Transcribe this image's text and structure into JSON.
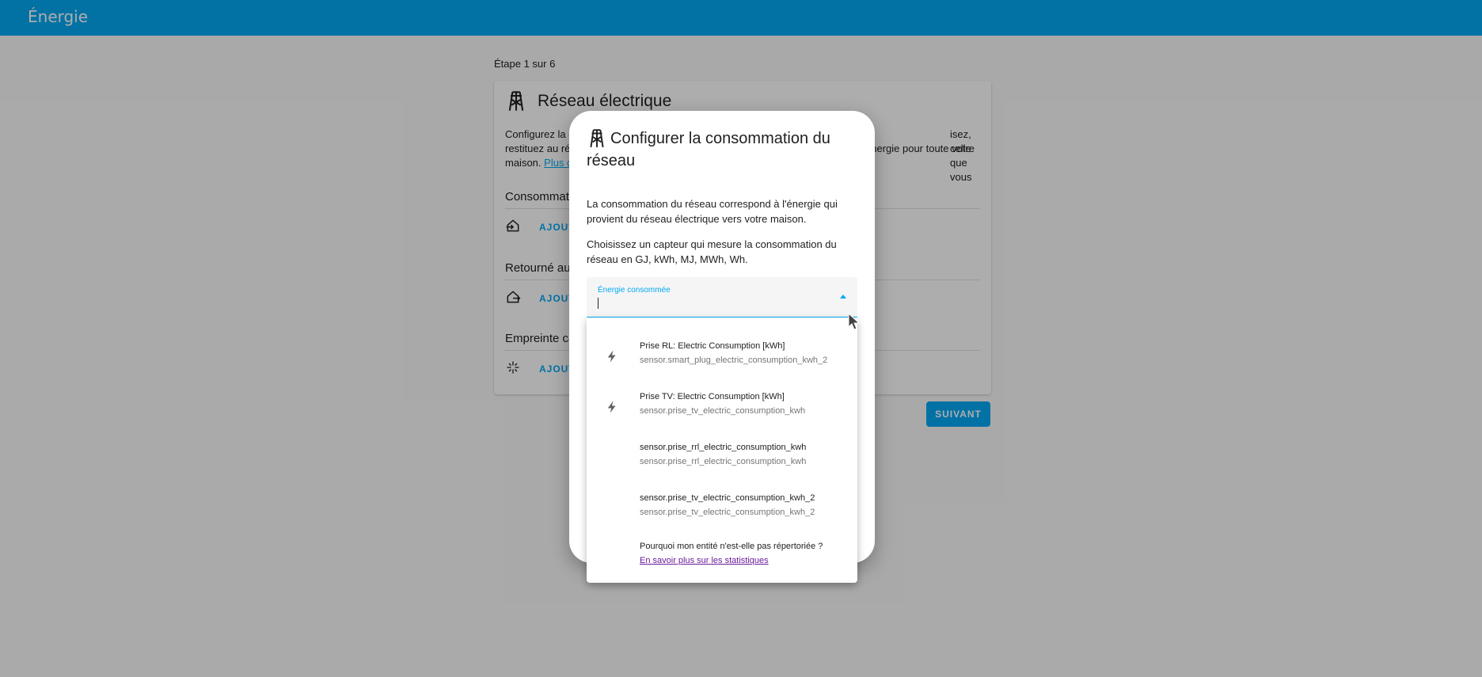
{
  "header": {
    "title": "Énergie"
  },
  "wizard": {
    "step_label": "Étape 1 sur 6",
    "next_label": "SUIVANT"
  },
  "card": {
    "title": "Réseau électrique",
    "desc_line1_left": "Configurez la c",
    "desc_line1_right": "isez, celle que vous",
    "desc_line2_left": "restituez au rés",
    "desc_line2_right": "énergie pour toute votre",
    "desc_line3_left": "maison.",
    "desc_link": "Plus d",
    "sections": [
      {
        "title": "Consommati",
        "action": "AJOUT",
        "icon": "home-import-icon"
      },
      {
        "title": "Retourné au",
        "action": "AJOUT",
        "icon": "home-export-icon"
      },
      {
        "title": "Empreinte ca",
        "action": "AJOUT",
        "icon": "leaf-sparkle-icon"
      }
    ]
  },
  "dialog": {
    "title": "Configurer la consommation du réseau",
    "p1": "La consommation du réseau correspond à l'énergie qui provient du réseau électrique vers votre maison.",
    "p2": "Choisissez un capteur qui mesure la consommation du réseau en GJ, kWh, MJ, MWh, Wh.",
    "field_label": "Énergie consommée",
    "options": [
      {
        "primary": "Prise RL: Electric Consumption [kWh]",
        "secondary": "sensor.smart_plug_electric_consumption_kwh_2",
        "icon": "lightning-bolt-icon"
      },
      {
        "primary": "Prise TV: Electric Consumption [kWh]",
        "secondary": "sensor.prise_tv_electric_consumption_kwh",
        "icon": "lightning-bolt-icon"
      },
      {
        "primary": "sensor.prise_rrl_electric_consumption_kwh",
        "secondary": "sensor.prise_rrl_electric_consumption_kwh",
        "icon": ""
      },
      {
        "primary": "sensor.prise_tv_electric_consumption_kwh_2",
        "secondary": "sensor.prise_tv_electric_consumption_kwh_2",
        "icon": ""
      }
    ],
    "help_question": "Pourquoi mon entité n'est-elle pas répertoriée ?",
    "help_link": "En savoir plus sur les statistiques"
  },
  "colors": {
    "primary": "#03a9f4",
    "link_visited": "#6a1b9a",
    "scrim": "rgba(0,0,0,0.32)"
  }
}
